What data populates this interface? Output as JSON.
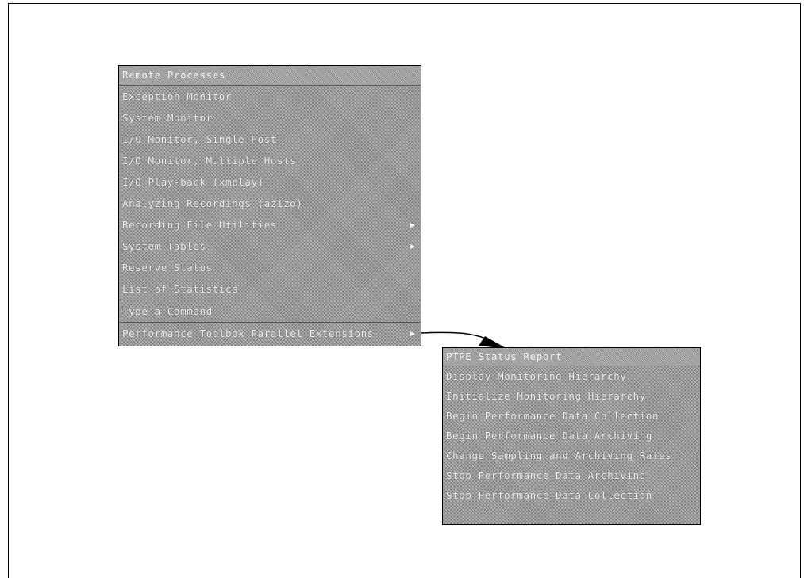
{
  "remote_menu": {
    "title": "Remote Processes",
    "items": [
      {
        "label": "Exception Monitor",
        "cascade": ""
      },
      {
        "label": "System Monitor",
        "cascade": ""
      },
      {
        "label": "I/O Monitor, Single Host",
        "cascade": ""
      },
      {
        "label": "I/O Monitor, Multiple Hosts",
        "cascade": ""
      },
      {
        "label": "I/O Play-back (xmplay)",
        "cascade": ""
      },
      {
        "label": "Analyzing Recordings (azizo)",
        "cascade": ""
      },
      {
        "label": "Recording File Utilities",
        "cascade": "▶"
      },
      {
        "label": "System Tables",
        "cascade": "▶"
      },
      {
        "label": "Reserve Status",
        "cascade": ""
      },
      {
        "label": "List of Statistics",
        "cascade": ""
      },
      {
        "label": "Type a Command",
        "cascade": ""
      },
      {
        "label": "Performance Toolbox Parallel Extensions",
        "cascade": "▶"
      }
    ]
  },
  "pte_menu": {
    "title": "PTPE Status Report",
    "items": [
      {
        "label": "Display Monitoring Hierarchy"
      },
      {
        "label": "Initialize Monitoring Hierarchy"
      },
      {
        "label": "Begin Performance Data Collection"
      },
      {
        "label": "Begin Performance Data Archiving"
      },
      {
        "label": "Change Sampling and Archiving Rates"
      },
      {
        "label": "Stop Performance Data Archiving"
      },
      {
        "label": "Stop Performance Data Collection"
      }
    ]
  }
}
